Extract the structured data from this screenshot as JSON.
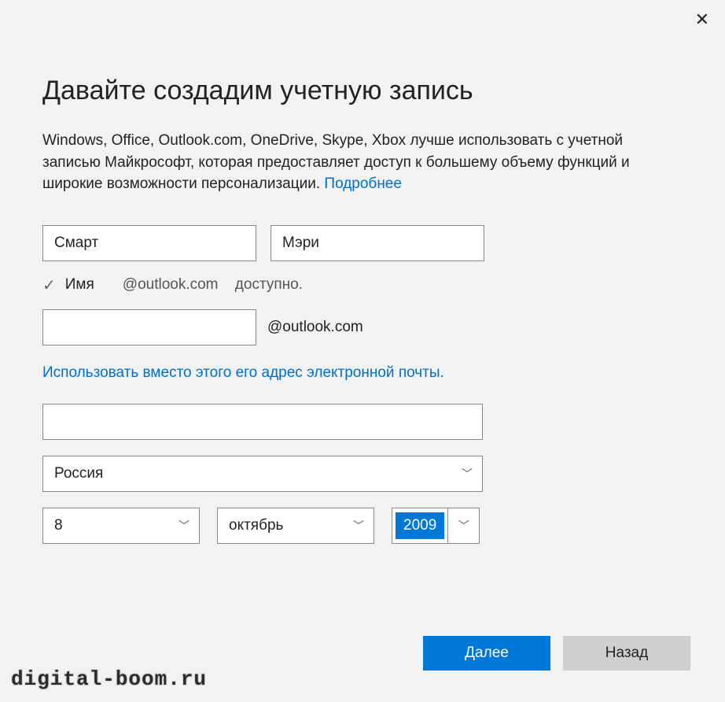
{
  "title": "Давайте создадим учетную запись",
  "description_main": "Windows, Office, Outlook.com, OneDrive, Skype, Xbox лучше использовать с учетной записью Майкрософт, которая предоставляет доступ к большему объему функций и широкие возможности персонализации. ",
  "description_link": "Подробнее",
  "form": {
    "first_name": "Смарт",
    "last_name": "Мэри",
    "availability_name": "Имя",
    "availability_domain": "@outlook.com",
    "availability_status": "доступно.",
    "email_local": "",
    "email_domain": "@outlook.com",
    "use_existing_email": "Использовать вместо этого его адрес электронной почты.",
    "password": "",
    "country": "Россия",
    "birth_day": "8",
    "birth_month": "октябрь",
    "birth_year": "2009"
  },
  "buttons": {
    "next": "Далее",
    "back": "Назад"
  },
  "watermark": "digital-boom.ru",
  "colors": {
    "accent": "#0078d7",
    "link": "#006fc7"
  }
}
